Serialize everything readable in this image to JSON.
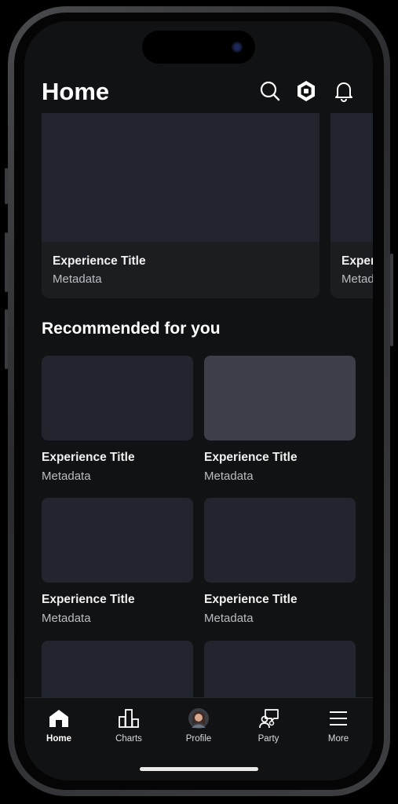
{
  "header": {
    "title": "Home"
  },
  "featured": [
    {
      "title": "Experience Title",
      "meta": "Metadata"
    },
    {
      "title": "Experience Title",
      "meta": "Metadata"
    }
  ],
  "recommended": {
    "title": "Recommended for you",
    "items": [
      {
        "title": "Experience Title",
        "meta": "Metadata"
      },
      {
        "title": "Experience Title",
        "meta": "Metadata"
      },
      {
        "title": "Experience Title",
        "meta": "Metadata"
      },
      {
        "title": "Experience Title",
        "meta": "Metadata"
      },
      {
        "title": "",
        "meta": ""
      },
      {
        "title": "",
        "meta": ""
      }
    ]
  },
  "tabs": [
    {
      "label": "Home",
      "icon": "home-icon"
    },
    {
      "label": "Charts",
      "icon": "charts-icon"
    },
    {
      "label": "Profile",
      "icon": "avatar"
    },
    {
      "label": "Party",
      "icon": "party-icon"
    },
    {
      "label": "More",
      "icon": "menu-icon"
    }
  ],
  "colors": {
    "background": "#111214",
    "thumbnail": "#22252d",
    "thumbnail_highlight": "#3d4049",
    "text": "#ffffff",
    "metadata": "#bcbdc2"
  }
}
